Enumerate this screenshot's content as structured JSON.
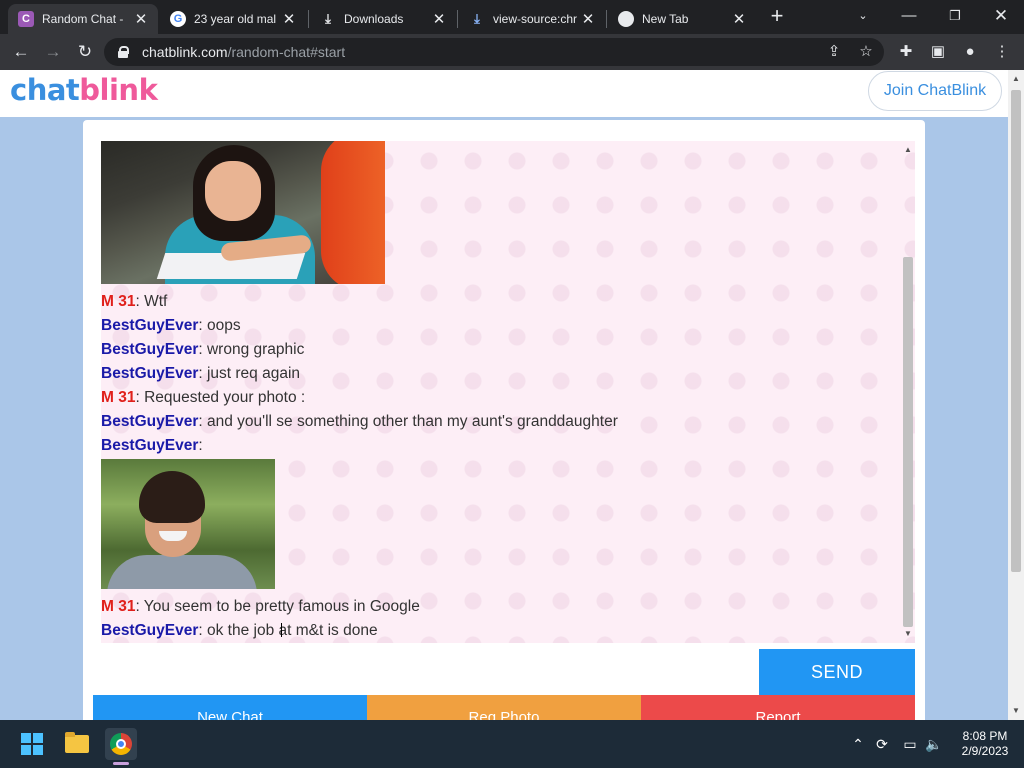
{
  "browser": {
    "tabs": [
      {
        "title": "Random Chat - ",
        "active": true,
        "icon": "chatblink-favicon"
      },
      {
        "title": "23 year old mal",
        "active": false,
        "icon": "google-icon"
      },
      {
        "title": "Downloads",
        "active": false,
        "icon": "download-icon"
      },
      {
        "title": "view-source:chr",
        "active": false,
        "icon": "download-icon"
      },
      {
        "title": "New Tab",
        "active": false,
        "icon": "chrome-icon"
      }
    ],
    "url_host": "chatblink.com",
    "url_path": "/random-chat#start"
  },
  "site": {
    "logo_part1": "chat",
    "logo_part2": "blink",
    "join_label": "Join ChatBlink"
  },
  "chat": {
    "messages": [
      {
        "nick": "M 31",
        "role": "stranger",
        "text": ": Wtf"
      },
      {
        "nick": "BestGuyEver",
        "role": "me",
        "text": ": oops"
      },
      {
        "nick": "BestGuyEver",
        "role": "me",
        "text": ": wrong graphic"
      },
      {
        "nick": "BestGuyEver",
        "role": "me",
        "text": ": just req again"
      },
      {
        "nick": "M 31",
        "role": "stranger",
        "text": ": Requested your photo :"
      },
      {
        "nick": "BestGuyEver",
        "role": "me",
        "text": ": and you'll se something other than my aunt's granddaughter"
      },
      {
        "nick": "BestGuyEver",
        "role": "me",
        "text": ":"
      },
      {
        "nick": "M 31",
        "role": "stranger",
        "text": ": You seem to be pretty famous in Google"
      },
      {
        "nick": "BestGuyEver",
        "role": "me",
        "text": ": ok the job at m&t is done"
      }
    ],
    "send_label": "SEND",
    "input_value": "",
    "actions": {
      "new_chat": "New Chat",
      "req_photo": "Req Photo",
      "report": "Report"
    }
  },
  "taskbar": {
    "time": "8:08 PM",
    "date": "2/9/2023"
  },
  "colors": {
    "stranger_nick": "#e0201b",
    "me_nick": "#1a1aa8",
    "send": "#2196f3",
    "req_photo": "#f0a040",
    "report": "#ec4a4a"
  }
}
